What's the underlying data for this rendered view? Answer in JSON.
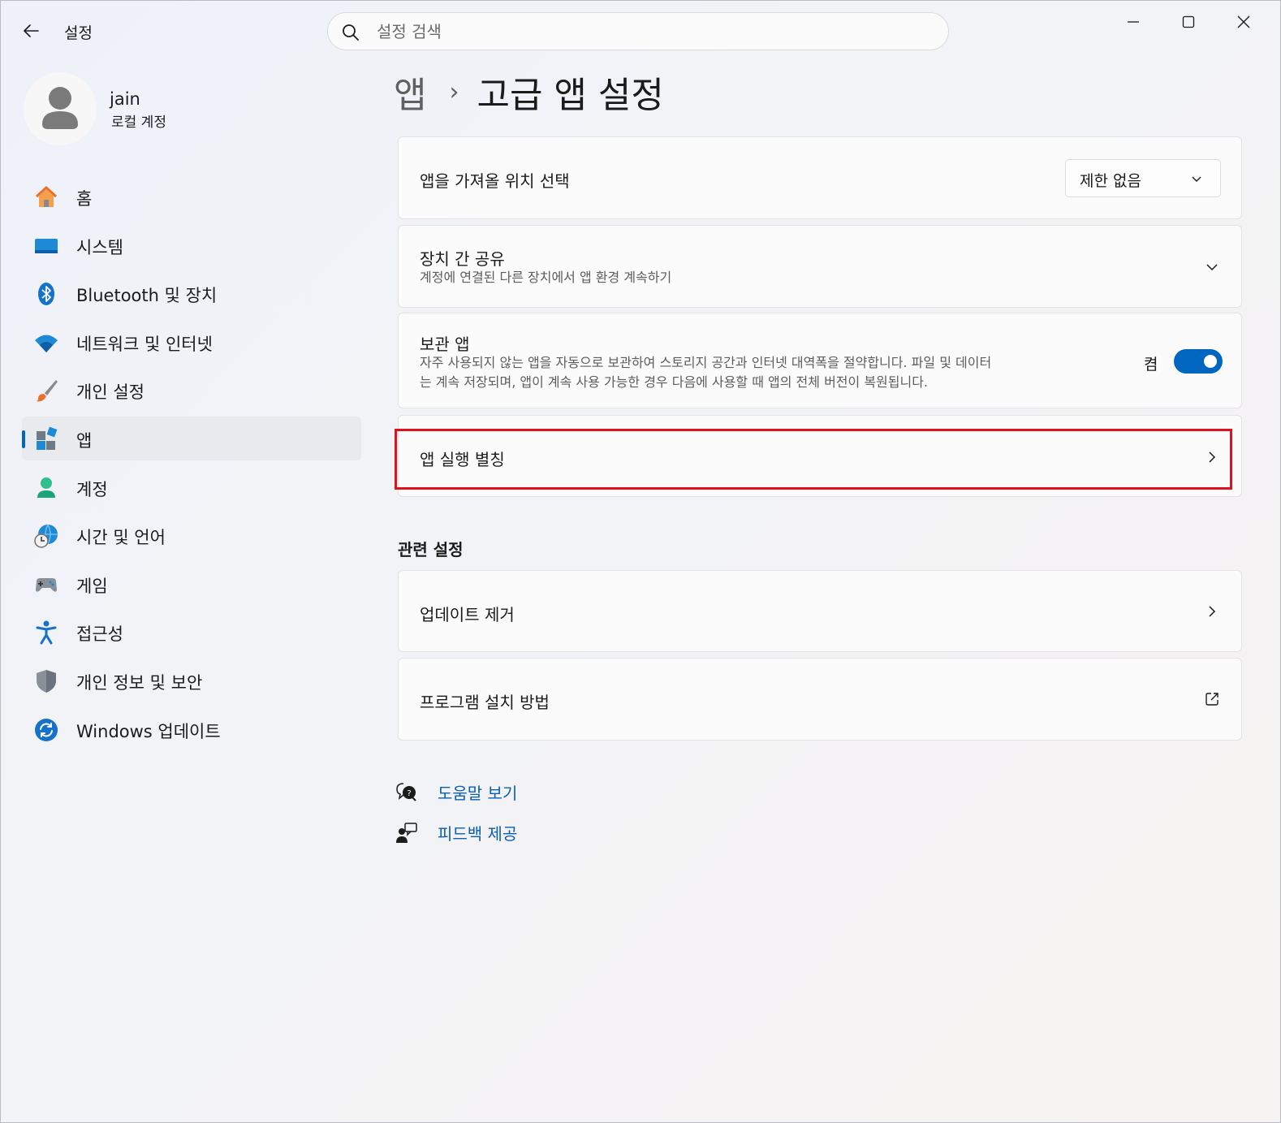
{
  "window": {
    "title": "설정",
    "controls": [
      "minimize-icon",
      "maximize-icon",
      "close-icon"
    ]
  },
  "search": {
    "placeholder": "설정 검색",
    "value": ""
  },
  "profile": {
    "name": "jain",
    "account_type": "로컬 계정"
  },
  "sidebar": {
    "items": [
      {
        "label": "홈",
        "icon": "home-icon",
        "active": false
      },
      {
        "label": "시스템",
        "icon": "system-icon",
        "active": false
      },
      {
        "label": "Bluetooth 및 장치",
        "icon": "bluetooth-icon",
        "active": false
      },
      {
        "label": "네트워크 및 인터넷",
        "icon": "wifi-icon",
        "active": false
      },
      {
        "label": "개인 설정",
        "icon": "brush-icon",
        "active": false
      },
      {
        "label": "앱",
        "icon": "apps-icon",
        "active": true
      },
      {
        "label": "계정",
        "icon": "account-icon",
        "active": false
      },
      {
        "label": "시간 및 언어",
        "icon": "globe-clock-icon",
        "active": false
      },
      {
        "label": "게임",
        "icon": "gamepad-icon",
        "active": false
      },
      {
        "label": "접근성",
        "icon": "accessibility-icon",
        "active": false
      },
      {
        "label": "개인 정보 및 보안",
        "icon": "shield-icon",
        "active": false
      },
      {
        "label": "Windows 업데이트",
        "icon": "update-icon",
        "active": false
      }
    ]
  },
  "breadcrumb": {
    "parent": "앱",
    "separator": "›",
    "current": "고급 앱 설정"
  },
  "settings": {
    "app_source": {
      "title": "앱을 가져올 위치 선택",
      "dropdown_value": "제한 없음"
    },
    "share_across_devices": {
      "title": "장치 간 공유",
      "description": "계정에 연결된 다른 장치에서 앱 환경 계속하기"
    },
    "archive_apps": {
      "title": "보관 앱",
      "description_line1": "자주 사용되지 않는 앱을 자동으로 보관하여 스토리지 공간과 인터넷 대역폭을 절약합니다. 파일 및 데이터",
      "description_line2": "는 계속 저장되며, 앱이 계속 사용 가능한 경우 다음에 사용할 때 앱의 전체 버전이 복원됩니다.",
      "toggle_label": "켬",
      "toggle_on": true
    },
    "app_execution_alias": {
      "title": "앱 실행 별칭"
    }
  },
  "related": {
    "heading": "관련 설정",
    "items": [
      {
        "title": "업데이트 제거",
        "icon": "chevron-right-icon"
      },
      {
        "title": "프로그램 설치 방법",
        "icon": "external-link-icon"
      }
    ]
  },
  "help": {
    "get_help": "도움말 보기",
    "give_feedback": "피드백 제공"
  },
  "colors": {
    "accent": "#0067c0",
    "highlight_border": "#e0101e",
    "link": "#0a5fb0"
  }
}
